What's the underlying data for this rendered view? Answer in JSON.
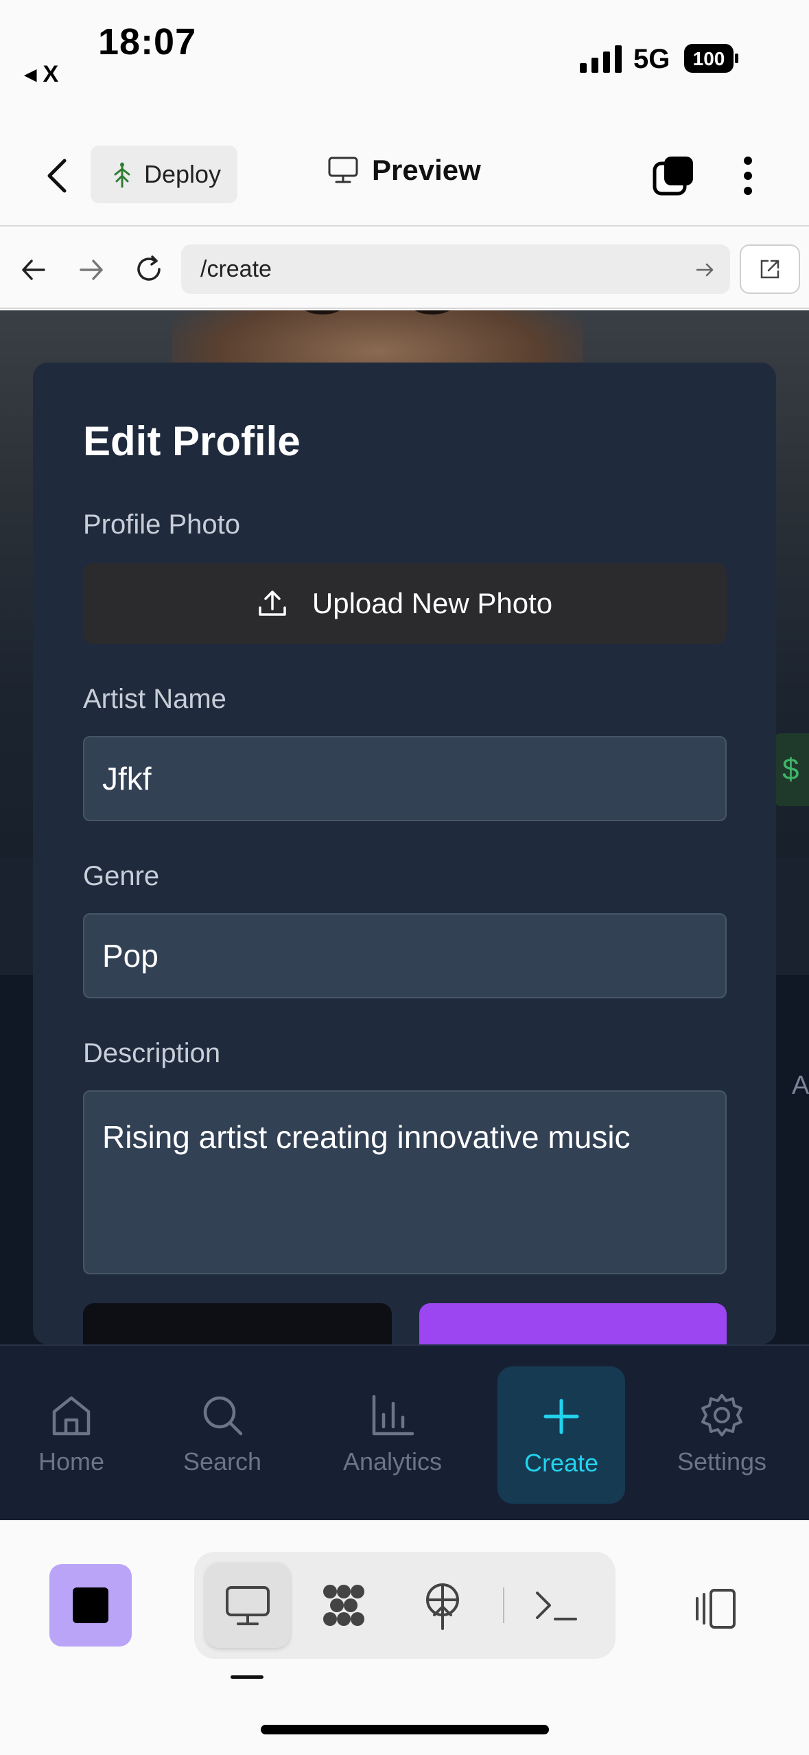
{
  "status_bar": {
    "time": "18:07",
    "back_label": "◂ X",
    "network": "5G",
    "battery": "100"
  },
  "app_header": {
    "deploy_label": "Deploy",
    "preview_label": "Preview"
  },
  "url_bar": {
    "url": "/create"
  },
  "modal": {
    "title": "Edit Profile",
    "profile_photo_label": "Profile Photo",
    "upload_label": "Upload New Photo",
    "artist_name_label": "Artist Name",
    "artist_name_value": "Jfkf",
    "genre_label": "Genre",
    "genre_value": "Pop",
    "description_label": "Description",
    "description_value": "Rising artist creating innovative music"
  },
  "background": {
    "side_chip": "$",
    "side_letter": "A"
  },
  "bottom_nav": {
    "items": [
      {
        "label": "Home",
        "icon": "home-icon"
      },
      {
        "label": "Search",
        "icon": "search-icon"
      },
      {
        "label": "Analytics",
        "icon": "bar-chart-icon"
      },
      {
        "label": "Create",
        "icon": "plus-icon",
        "active": true
      },
      {
        "label": "Settings",
        "icon": "gear-icon"
      }
    ],
    "active_color": "#22d3ee"
  },
  "colors": {
    "accent_purple": "#9b46f0",
    "modal_bg": "#1f2a3d",
    "input_bg": "#334155"
  }
}
